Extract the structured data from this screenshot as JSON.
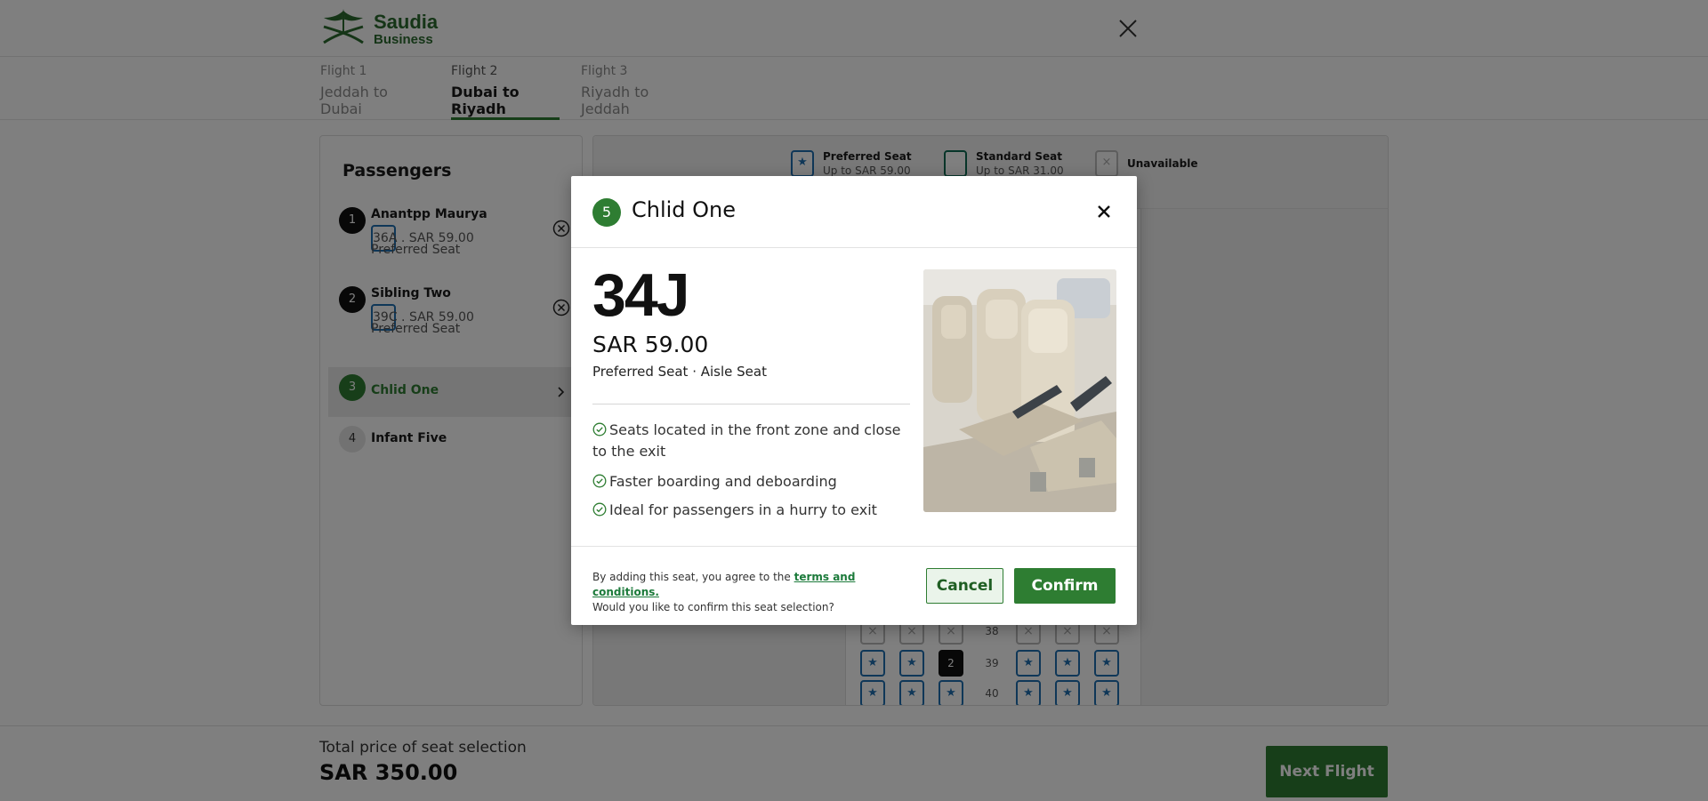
{
  "brand": {
    "line1": "Saudia",
    "line2": "Business",
    "color": "#2b6a2f"
  },
  "flights": [
    {
      "label": "Flight 1",
      "route": "Jeddah to Dubai",
      "active": false
    },
    {
      "label": "Flight 2",
      "route": "Dubai to Riyadh",
      "active": true
    },
    {
      "label": "Flight 3",
      "route": "Riyadh to Jeddah",
      "active": false
    }
  ],
  "passengers": {
    "title": "Passengers",
    "list": [
      {
        "num": "1",
        "name": "Anantpp Maurya",
        "seat": "36A . SAR  59.00",
        "type": "Preferred Seat"
      },
      {
        "num": "2",
        "name": "Sibling Two",
        "seat": "39C . SAR  59.00",
        "type": "Preferred Seat"
      },
      {
        "num": "3",
        "name": "Chlid One"
      },
      {
        "num": "4",
        "name": "Infant Five"
      }
    ]
  },
  "legend": {
    "preferred": {
      "title": "Preferred Seat",
      "sub": "Up to SAR 59.00"
    },
    "standard": {
      "title": "Standard Seat",
      "sub": "Up to SAR 31.00"
    },
    "unavailable": {
      "title": "Unavailable"
    }
  },
  "seatmap": {
    "rows": [
      {
        "row": "38",
        "seats": [
          "x",
          "x",
          "x",
          "x",
          "x",
          "x"
        ]
      },
      {
        "row": "39",
        "seats": [
          "p",
          "p",
          "2",
          "p",
          "p",
          "p"
        ]
      },
      {
        "row": "40",
        "seats": [
          "p",
          "p",
          "p",
          "p",
          "p",
          "p"
        ]
      }
    ]
  },
  "modal": {
    "badge": "5",
    "passenger": "Chlid One",
    "seat": "34J",
    "price": "SAR 59.00",
    "desc": "Preferred Seat · Aisle Seat",
    "features": [
      "Seats located in the front zone and close to the exit",
      "Faster boarding and deboarding",
      "Ideal for passengers in a hurry to exit"
    ],
    "terms_prefix": "By adding this seat, you agree to the ",
    "terms_link": "terms and conditions.",
    "terms_question": "Would you like to confirm this seat selection?",
    "cancel": "Cancel",
    "confirm": "Confirm"
  },
  "footer": {
    "total_label": "Total price of seat selection",
    "total_value": "SAR 350.00",
    "next": "Next Flight"
  },
  "colors": {
    "accent": "#2e7d32",
    "preferred": "#1f6fb0",
    "standard": "#0e6a52"
  }
}
